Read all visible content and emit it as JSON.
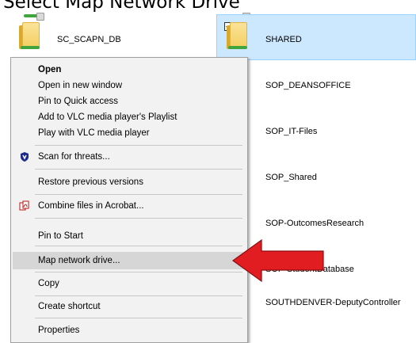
{
  "title": "Select Map Network Drive",
  "folders": {
    "left_top": "SC_SCAPN_DB",
    "right": [
      "SHARED",
      "SOP_DEANSOFFICE",
      "SOP_IT-Files",
      "SOP_Shared",
      "SOP-OutcomesResearch",
      "SOP-StudentDatabase",
      "SOUTHDENVER-DeputyController"
    ],
    "selected": "SHARED"
  },
  "context_menu": {
    "items": [
      {
        "label": "Open",
        "bold": true
      },
      {
        "label": "Open in new window"
      },
      {
        "label": "Pin to Quick access"
      },
      {
        "label": "Add to VLC media player's Playlist"
      },
      {
        "label": "Play with VLC media player"
      },
      {
        "label": "Scan for threats...",
        "icon": "shield-icon"
      },
      {
        "label": "Restore previous versions"
      },
      {
        "label": "Combine files in Acrobat...",
        "icon": "acrobat-icon"
      },
      {
        "label": "Pin to Start"
      },
      {
        "label": "Map network drive...",
        "highlighted": true
      },
      {
        "label": "Copy"
      },
      {
        "label": "Create shortcut"
      },
      {
        "label": "Properties"
      }
    ]
  },
  "colors": {
    "selection_bg": "#cce8ff",
    "menu_bg": "#f2f2f2",
    "menu_hover": "#d6d6d6",
    "arrow_red": "#e11d22",
    "network_green": "#41a53d"
  }
}
